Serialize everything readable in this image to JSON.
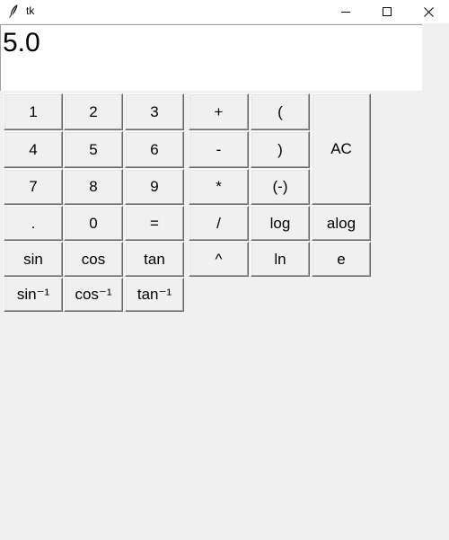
{
  "window": {
    "title": "tk",
    "icon": "tk-feather-icon",
    "controls": [
      "minimize-icon",
      "maximize-icon",
      "close-icon"
    ]
  },
  "display": {
    "value": "5.0"
  },
  "keypad": {
    "row1": [
      "1",
      "2",
      "3",
      "+",
      "("
    ],
    "row2": [
      "4",
      "5",
      "6",
      "-",
      ")"
    ],
    "row3": [
      "7",
      "8",
      "9",
      "*",
      "(-)"
    ],
    "ac": "AC",
    "row4": [
      ".",
      "0",
      "=",
      "/",
      "log",
      "alog"
    ],
    "row5": [
      "sin",
      "cos",
      "tan",
      "^",
      "ln",
      "e"
    ],
    "row6": [
      "sin⁻¹",
      "cos⁻¹",
      "tan⁻¹"
    ]
  }
}
